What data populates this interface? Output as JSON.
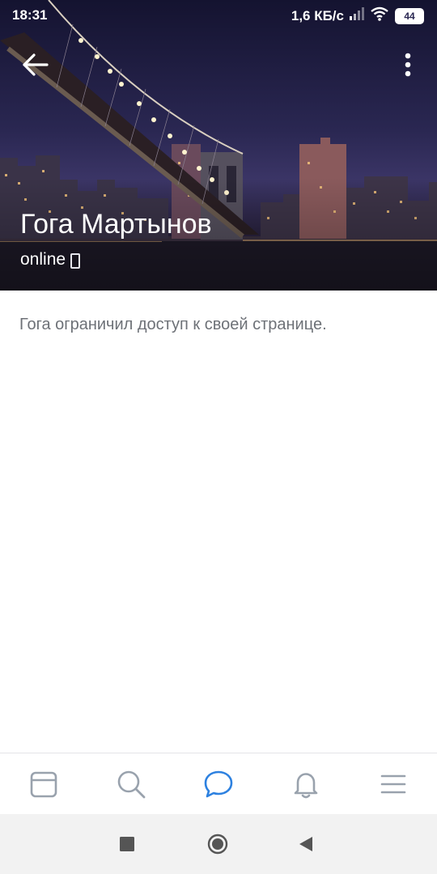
{
  "status_bar": {
    "time": "18:31",
    "network_speed": "1,6 КБ/с",
    "battery_level": "44",
    "icons": [
      "signal-icon",
      "wifi-icon",
      "battery-icon"
    ]
  },
  "app_bar": {
    "back_icon": "arrow-left-icon",
    "menu_icon": "more-vertical-icon"
  },
  "profile": {
    "name": "Гога Мартынов",
    "status": "online",
    "status_icon": "mobile-phone-icon"
  },
  "content": {
    "restricted_message": "Гога ограничил доступ к своей странице."
  },
  "tab_bar": {
    "tabs": [
      {
        "icon": "news-feed-icon",
        "active": false
      },
      {
        "icon": "search-icon",
        "active": false
      },
      {
        "icon": "messages-icon",
        "active": true
      },
      {
        "icon": "notifications-bell-icon",
        "active": false
      },
      {
        "icon": "menu-icon",
        "active": false
      }
    ],
    "active_color": "#2d81e0",
    "inactive_color": "#99a2ad"
  },
  "system_nav": {
    "buttons": [
      "recent-apps-icon",
      "home-icon",
      "back-triangle-icon"
    ]
  }
}
